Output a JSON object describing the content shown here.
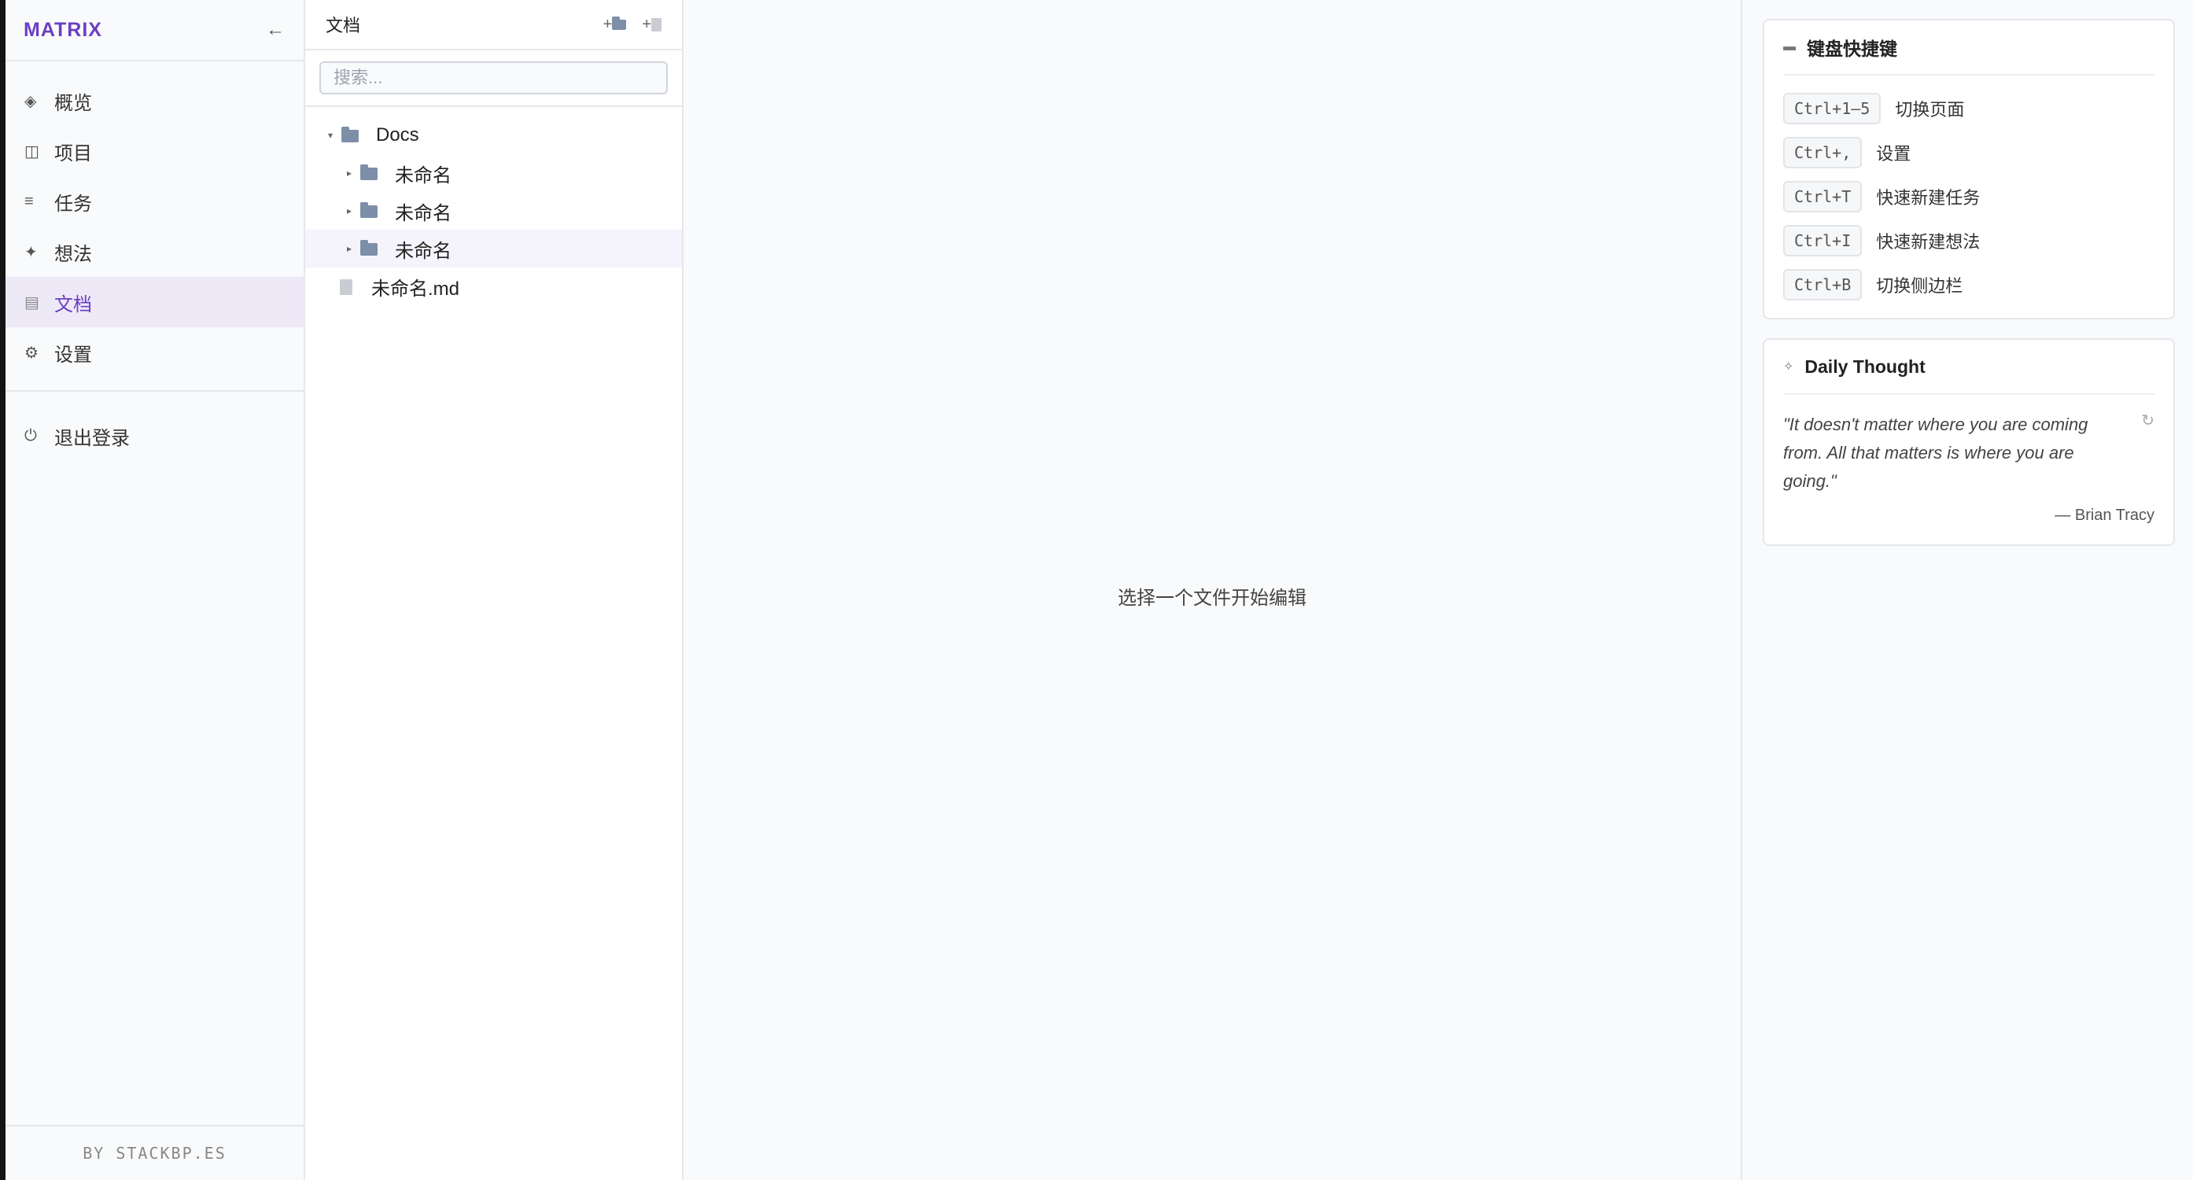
{
  "sidebar": {
    "brand": "MATRIX",
    "collapse_icon": "←",
    "items": [
      {
        "label": "概览",
        "icon": "◈"
      },
      {
        "label": "项目",
        "icon": "◫"
      },
      {
        "label": "任务",
        "icon": "≡"
      },
      {
        "label": "想法",
        "icon": "✦"
      },
      {
        "label": "文档",
        "icon": "▤"
      },
      {
        "label": "设置",
        "icon": "⚙"
      }
    ],
    "logout": {
      "label": "退出登录",
      "icon": "⏻"
    },
    "footer": "BY STACKBP.ES",
    "active_index": 4
  },
  "files": {
    "title": "文档",
    "new_folder_label": "+",
    "new_file_label": "+",
    "search_placeholder": "搜索...",
    "tree": [
      {
        "name": "Docs",
        "type": "folder",
        "expanded": true,
        "depth": 0
      },
      {
        "name": "未命名",
        "type": "folder",
        "expanded": false,
        "depth": 1
      },
      {
        "name": "未命名",
        "type": "folder",
        "expanded": false,
        "depth": 1
      },
      {
        "name": "未命名",
        "type": "folder",
        "expanded": false,
        "depth": 1,
        "selected": true
      },
      {
        "name": "未命名.md",
        "type": "file",
        "depth": 0
      }
    ]
  },
  "main": {
    "placeholder": "选择一个文件开始编辑"
  },
  "shortcuts_card": {
    "title": "键盘快捷键",
    "items": [
      {
        "key": "Ctrl+1—5",
        "label": "切换页面"
      },
      {
        "key": "Ctrl+,",
        "label": "设置"
      },
      {
        "key": "Ctrl+T",
        "label": "快速新建任务"
      },
      {
        "key": "Ctrl+I",
        "label": "快速新建想法"
      },
      {
        "key": "Ctrl+B",
        "label": "切换侧边栏"
      }
    ]
  },
  "thought_card": {
    "title": "Daily Thought",
    "quote": "\"It doesn't matter where you are coming from. All that matters is where you are going.\"",
    "author": "— Brian Tracy"
  },
  "colors": {
    "accent": "#6b3fc4",
    "active_bg": "#ede9f7"
  }
}
